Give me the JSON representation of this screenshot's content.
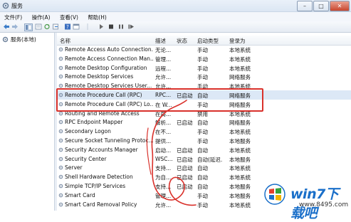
{
  "window": {
    "title": "服务"
  },
  "menu": [
    "文件(F)",
    "操作(A)",
    "查看(V)",
    "帮助(H)"
  ],
  "tree": {
    "root_label": "服务(本地)"
  },
  "columns": {
    "name": "名称",
    "desc": "描述",
    "status": "状态",
    "startup": "启动类型",
    "logon": "登录为"
  },
  "services": [
    {
      "name": "Remote Access Auto Connection...",
      "desc": "无论...",
      "status": "",
      "startup": "手动",
      "logon": "本地系统"
    },
    {
      "name": "Remote Access Connection Man...",
      "desc": "管理...",
      "status": "",
      "startup": "手动",
      "logon": "本地系统"
    },
    {
      "name": "Remote Desktop Configuration",
      "desc": "远程...",
      "status": "",
      "startup": "手动",
      "logon": "本地系统"
    },
    {
      "name": "Remote Desktop Services",
      "desc": "允许...",
      "status": "",
      "startup": "手动",
      "logon": "网络服务"
    },
    {
      "name": "Remote Desktop Services User...",
      "desc": "允许...",
      "status": "",
      "startup": "手动",
      "logon": "本地系统"
    },
    {
      "name": "Remote Procedure Call (RPC)",
      "desc": "RPC...",
      "status": "已启动",
      "startup": "自动",
      "logon": "网络服务"
    },
    {
      "name": "Remote Procedure Call (RPC) Lo...",
      "desc": "在 W...",
      "status": "",
      "startup": "手动",
      "logon": "网络服务"
    },
    {
      "name": "Routing and Remote Access",
      "desc": "在局...",
      "status": "",
      "startup": "禁用",
      "logon": "本地系统"
    },
    {
      "name": "RPC Endpoint Mapper",
      "desc": "解析...",
      "status": "已启动",
      "startup": "自动",
      "logon": "网络服务"
    },
    {
      "name": "Secondary Logon",
      "desc": "在不...",
      "status": "",
      "startup": "手动",
      "logon": "本地系统"
    },
    {
      "name": "Secure Socket Tunneling Protoc...",
      "desc": "提供...",
      "status": "",
      "startup": "手动",
      "logon": "本地服务"
    },
    {
      "name": "Security Accounts Manager",
      "desc": "启动...",
      "status": "已启动",
      "startup": "自动",
      "logon": "本地系统"
    },
    {
      "name": "Security Center",
      "desc": "WSC...",
      "status": "已启动",
      "startup": "自动(延迟...",
      "logon": "本地服务"
    },
    {
      "name": "Server",
      "desc": "支持...",
      "status": "已启动",
      "startup": "自动",
      "logon": "本地系统"
    },
    {
      "name": "Shell Hardware Detection",
      "desc": "为自...",
      "status": "已启动",
      "startup": "自动",
      "logon": "本地系统"
    },
    {
      "name": "Simple TCP/IP Services",
      "desc": "支持...",
      "status": "已启动",
      "startup": "自动",
      "logon": "本地服务"
    },
    {
      "name": "Smart Card",
      "desc": "管理...",
      "status": "",
      "startup": "手动",
      "logon": "本地服务"
    },
    {
      "name": "Smart Card Removal Policy",
      "desc": "允许...",
      "status": "",
      "startup": "手动",
      "logon": "本地系统"
    }
  ],
  "selected_index": 5,
  "watermark": {
    "brand": "win7下载吧",
    "url": "www.8495.com"
  },
  "colors": {
    "highlight": "#d9312b",
    "selection": "#dce8f6",
    "brand": "#1a6fc9"
  }
}
